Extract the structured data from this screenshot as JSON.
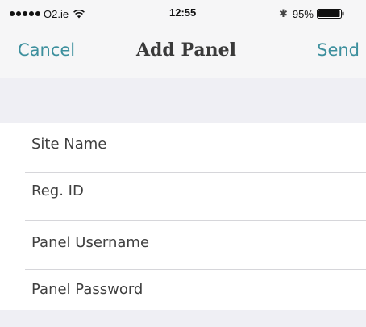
{
  "status_bar": {
    "carrier": "O2.ie",
    "time": "12:55",
    "battery_percent": "95%",
    "icons": [
      "signal-dots-icon",
      "wifi-icon",
      "bluetooth-icon",
      "battery-icon"
    ]
  },
  "nav": {
    "cancel_label": "Cancel",
    "title": "Add Panel",
    "send_label": "Send",
    "accent_color": "#3c8f9d"
  },
  "form": {
    "fields": [
      {
        "label": "Site Name"
      },
      {
        "label": "Reg. ID"
      },
      {
        "label": "Panel Username"
      },
      {
        "label": "Panel Password"
      }
    ]
  }
}
